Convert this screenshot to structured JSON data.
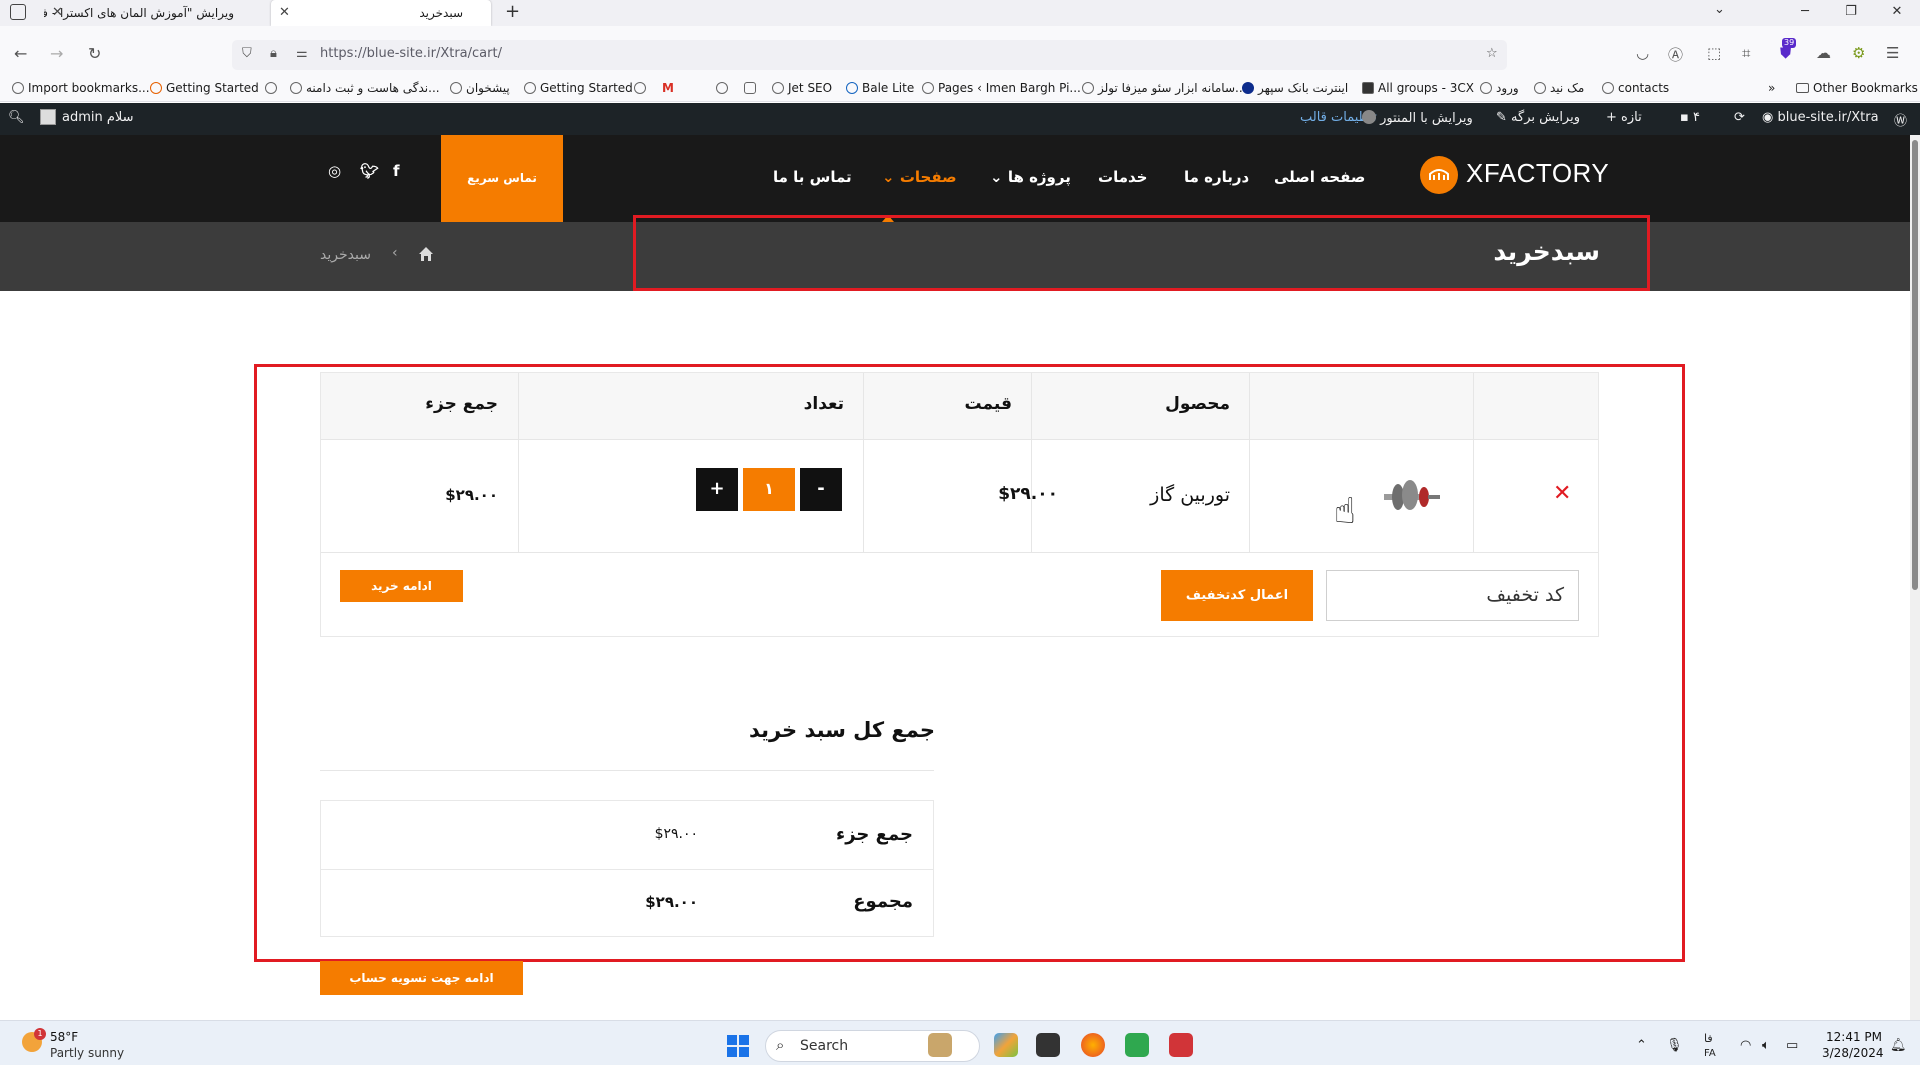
{
  "browser": {
    "tabs": [
      {
        "label": "ویرایش \"آموزش المان های اکسترا - ف"
      },
      {
        "label": "سبدخرید"
      }
    ],
    "new_tab": "+",
    "url": "https://blue-site.ir/Xtra/cart/",
    "extension_badge": "39",
    "bookmarks": [
      "Import bookmarks...",
      "Getting Started",
      "ندگی هاست و ثبت دامنه...",
      "پیشخوان",
      "Getting Started",
      "Jet SEO",
      "Bale Lite",
      "Pages ‹ Imen Bargh Pi...",
      "سامانه ابزار سئو میزفا تولز...",
      "اینترنت بانک سپهر",
      "All groups - 3CX",
      "ورود",
      "مک نید",
      "contacts"
    ],
    "other_bookmarks": "Other Bookmarks"
  },
  "admin_bar": {
    "greeting": "سلام admin",
    "site": "blue-site.ir/Xtra",
    "updates": "۴",
    "new": "تازه",
    "edit_page": "ویرایش برگه",
    "edit_elementor": "ویرایش با المنتور",
    "theme_settings": "تنظیمات قالب"
  },
  "header": {
    "logo": "XFACTORY",
    "menu": [
      "صفحه اصلی",
      "درباره ما",
      "خدمات",
      "پروژه ها",
      "صفحات",
      "تماس با ما"
    ],
    "quick_contact": "تماس سریع",
    "accent_color": "#f57c00"
  },
  "title_bar": {
    "title": "سبدخرید",
    "breadcrumb_current": "سبدخرید"
  },
  "cart": {
    "headers": {
      "product": "محصول",
      "price": "قیمت",
      "quantity": "تعداد",
      "subtotal": "جمع جزء"
    },
    "item": {
      "name": "توربین گاز",
      "price": "$۲۹.۰۰",
      "quantity": "۱",
      "subtotal": "$۲۹.۰۰"
    },
    "qty_minus": "-",
    "qty_plus": "+",
    "coupon_placeholder": "کد تخفیف",
    "apply_coupon": "اعمال کدتخفیف",
    "continue_shopping": "ادامه خرید"
  },
  "totals": {
    "title": "جمع کل سبد خرید",
    "subtotal_label": "جمع جزء",
    "subtotal_value": "$۲۹.۰۰",
    "total_label": "مجموع",
    "total_value": "$۲۹.۰۰",
    "checkout": "ادامه جهت تسویه حساب"
  },
  "taskbar": {
    "temperature": "58°F",
    "condition": "Partly sunny",
    "weather_badge": "1",
    "search": "Search",
    "lang": "فا",
    "lang2": "FA",
    "time": "12:41 PM",
    "date": "3/28/2024"
  }
}
